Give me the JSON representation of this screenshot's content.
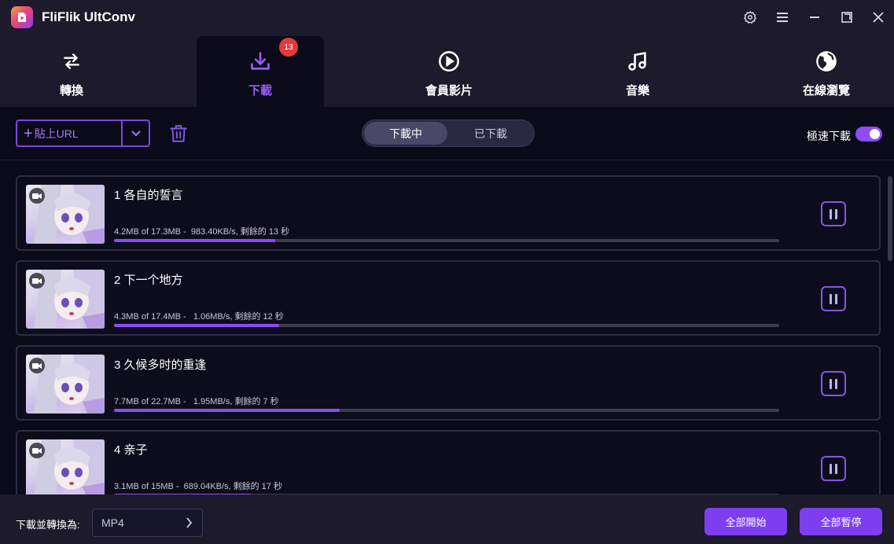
{
  "app": {
    "title": "FliFlik UltConv",
    "accent": "#8a4cf6"
  },
  "window_controls": [
    "gear-icon",
    "menu-icon",
    "minimize-icon",
    "maximize-icon",
    "close-icon"
  ],
  "tabs": [
    {
      "label": "轉換",
      "icon": "swap-icon"
    },
    {
      "label": "下載",
      "icon": "download-icon",
      "badge": "13",
      "active": true
    },
    {
      "label": "會員影片",
      "icon": "play-circle-icon"
    },
    {
      "label": "音樂",
      "icon": "music-note-icon"
    },
    {
      "label": "在線瀏覽",
      "icon": "globe-icon"
    }
  ],
  "toolbar": {
    "paste_label": "貼上URL",
    "segments": [
      "下載中",
      "已下載"
    ],
    "active_segment": 0,
    "turbo_label": "極速下載",
    "turbo_on": true
  },
  "downloads": [
    {
      "title": "1 各自的誓言",
      "stats": "4.2MB of 17.3MB -  983.40KB/s, 剩餘的 13 秒",
      "progress": 0.242
    },
    {
      "title": "2 下一个地方",
      "stats": "4.3MB of 17.4MB -   1.06MB/s, 剩餘的 12 秒",
      "progress": 0.248
    },
    {
      "title": "3 久候多时的重逢",
      "stats": "7.7MB of 22.7MB -   1.95MB/s, 剩餘的 7 秒",
      "progress": 0.339
    },
    {
      "title": "4 亲子",
      "stats": "3.1MB of 15MB -  689.04KB/s, 剩餘的 17 秒",
      "progress": 0.207
    }
  ],
  "footer": {
    "convert_label": "下載並轉換為:",
    "format": "MP4",
    "start_all": "全部開始",
    "pause_all": "全部暫停"
  }
}
